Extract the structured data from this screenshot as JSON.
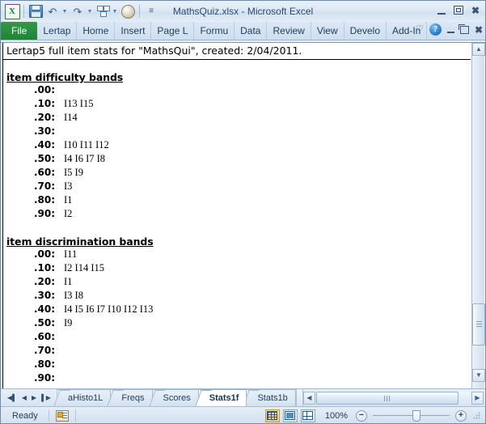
{
  "window": {
    "title": "MathsQuiz.xlsx  -  Microsoft Excel",
    "app_icon": "excel-icon",
    "minimize_label": "Minimize",
    "restore_label": "Restore Down",
    "close_label": "Close"
  },
  "quick_access": {
    "items": [
      {
        "name": "save-icon",
        "label": "Save"
      },
      {
        "name": "undo-icon",
        "label": "Undo",
        "glyph": "↶"
      },
      {
        "name": "redo-icon",
        "label": "Redo",
        "glyph": "↷"
      },
      {
        "name": "quick-print-icon",
        "label": "Print Preview"
      },
      {
        "name": "lertap-globe-icon",
        "label": "Lertap"
      },
      {
        "name": "customize-qat-icon",
        "label": "Customize Quick Access Toolbar",
        "glyph": "≡"
      }
    ]
  },
  "ribbon": {
    "tabs": [
      {
        "label": "File",
        "active": false,
        "name": "tab-file"
      },
      {
        "label": "Lertap",
        "active": false,
        "name": "tab-lertap"
      },
      {
        "label": "Home",
        "active": false,
        "name": "tab-home"
      },
      {
        "label": "Insert",
        "active": false,
        "name": "tab-insert"
      },
      {
        "label": "Page L",
        "active": false,
        "name": "tab-page-layout"
      },
      {
        "label": "Formu",
        "active": false,
        "name": "tab-formulas"
      },
      {
        "label": "Data",
        "active": false,
        "name": "tab-data"
      },
      {
        "label": "Review",
        "active": false,
        "name": "tab-review"
      },
      {
        "label": "View",
        "active": false,
        "name": "tab-view"
      },
      {
        "label": "Develo",
        "active": false,
        "name": "tab-developer"
      },
      {
        "label": "Add-In",
        "active": false,
        "name": "tab-add-ins"
      }
    ],
    "collapse_icon": "♡",
    "help_label": "?"
  },
  "document": {
    "header_line": "Lertap5 full item stats for \"MathsQui\", created: 2/04/2011.",
    "sections": [
      {
        "title": "item difficulty bands",
        "name": "section-item-difficulty-bands",
        "bands": [
          {
            "band": ".00:",
            "items": ""
          },
          {
            "band": ".10:",
            "items": "I13 I15"
          },
          {
            "band": ".20:",
            "items": "I14"
          },
          {
            "band": ".30:",
            "items": ""
          },
          {
            "band": ".40:",
            "items": "I10 I11 I12"
          },
          {
            "band": ".50:",
            "items": "I4 I6 I7 I8"
          },
          {
            "band": ".60:",
            "items": "I5 I9"
          },
          {
            "band": ".70:",
            "items": "I3"
          },
          {
            "band": ".80:",
            "items": "I1"
          },
          {
            "band": ".90:",
            "items": "I2"
          }
        ]
      },
      {
        "title": "item discrimination bands",
        "name": "section-item-discrimination-bands",
        "bands": [
          {
            "band": ".00:",
            "items": "I11"
          },
          {
            "band": ".10:",
            "items": "I2 I14 I15"
          },
          {
            "band": ".20:",
            "items": "I1"
          },
          {
            "band": ".30:",
            "items": "I3 I8"
          },
          {
            "band": ".40:",
            "items": "I4 I5 I6 I7 I10 I12 I13"
          },
          {
            "band": ".50:",
            "items": "I9"
          },
          {
            "band": ".60:",
            "items": ""
          },
          {
            "band": ".70:",
            "items": ""
          },
          {
            "band": ".80:",
            "items": ""
          },
          {
            "band": ".90:",
            "items": ""
          }
        ]
      }
    ]
  },
  "sheet_tabs": {
    "nav": {
      "first": "◀┃",
      "prev": "◀",
      "next": "▶",
      "last": "┃▶"
    },
    "tabs": [
      {
        "label": "aHisto1L",
        "active": false,
        "name": "sheet-tab-ahisto1l"
      },
      {
        "label": "Freqs",
        "active": false,
        "name": "sheet-tab-freqs"
      },
      {
        "label": "Scores",
        "active": false,
        "name": "sheet-tab-scores"
      },
      {
        "label": "Stats1f",
        "active": true,
        "name": "sheet-tab-stats1f"
      },
      {
        "label": "Stats1b",
        "active": false,
        "name": "sheet-tab-stats1b"
      }
    ]
  },
  "status_bar": {
    "mode": "Ready",
    "macro_record_label": "Record Macro",
    "zoom_level": "100%",
    "view_buttons": [
      {
        "name": "view-normal",
        "label": "Normal",
        "selected": true
      },
      {
        "name": "view-page-layout",
        "label": "Page Layout",
        "selected": false
      },
      {
        "name": "view-page-break-preview",
        "label": "Page Break Preview",
        "selected": false
      }
    ],
    "zoom_out_label": "−",
    "zoom_in_label": "+"
  },
  "colors": {
    "file_tab_green": "#2f9c46",
    "title_text": "#2b4a70",
    "chrome_blue": "#d2e0f0",
    "active_sheet_tab": "#ffffff"
  }
}
